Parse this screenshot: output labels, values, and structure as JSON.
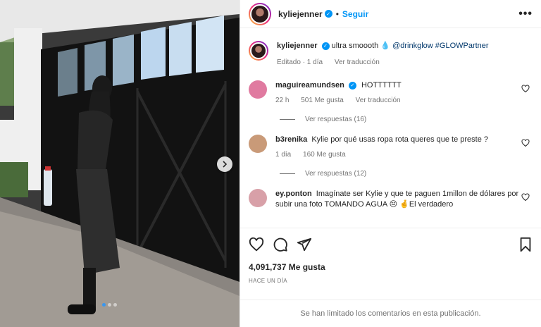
{
  "post": {
    "author": "kyliejenner",
    "follow_label": "Seguir",
    "more_label": "•••",
    "caption_user": "kyliejenner",
    "caption_text": "ultra smoooth",
    "caption_mention": "@drinkglow #GLOWPartner",
    "caption_meta_edited": "Editado · 1 día",
    "caption_meta_translate": "Ver traducción",
    "likes": "4,091,737 Me gusta",
    "date": "HACE UN DÍA",
    "comments_limited": "Se han limitado los comentarios en esta publicación."
  },
  "comments": [
    {
      "user": "maguireamundsen",
      "verified": true,
      "text": "HOTTTTTT",
      "time": "22 h",
      "likes": "501 Me gusta",
      "translate": "Ver traducción",
      "replies": "Ver respuestas (16)",
      "avatar_color": "#e07aa0"
    },
    {
      "user": "b3renika",
      "verified": false,
      "text": "Kylie por qué usas ropa rota queres que te preste ?",
      "time": "1 día",
      "likes": "160 Me gusta",
      "replies": "Ver respuestas (12)",
      "avatar_color": "#c99a78"
    },
    {
      "user": "ey.ponton",
      "verified": false,
      "text": "Imagínate ser Kylie y que te paguen 1millon de dólares por subir una foto TOMANDO AGUA 😔 🤞El verdadero",
      "avatar_color": "#d8a0a8"
    }
  ],
  "colors": {
    "accent": "#0095f6",
    "muted": "#737373"
  }
}
